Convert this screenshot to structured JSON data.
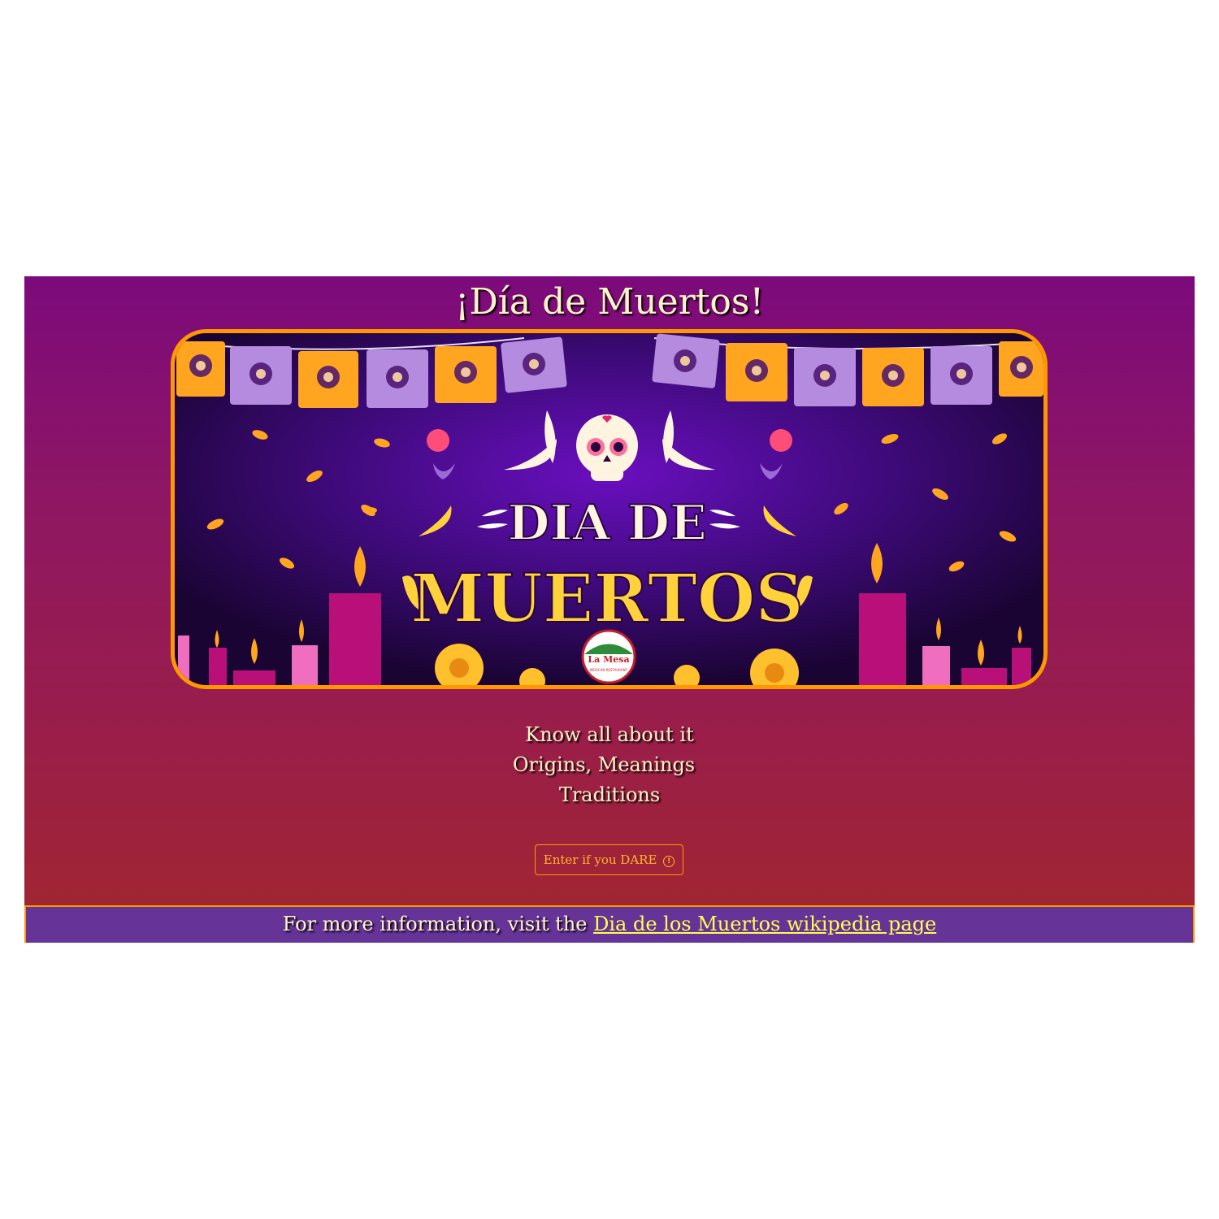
{
  "page": {
    "title": "¡Día de Muertos!",
    "banner": {
      "line1": "DIA DE",
      "line2": "MUERTOS",
      "logo_text": "La Mesa",
      "logo_subtext": "MEXICAN RESTAURANT"
    },
    "tagline": {
      "line1": "Know all about it",
      "line2": "Origins, Meanings",
      "line3": "Traditions"
    },
    "enter_button": {
      "label": "Enter if you DARE",
      "icon": "info-circle-icon"
    },
    "footer": {
      "prefix": "For more information, visit the ",
      "link_text": "Dia de los Muertos wikipedia page"
    }
  },
  "colors": {
    "gradient_top": "#7c0a7c",
    "gradient_bottom": "#a2272e",
    "accent_orange": "#ff9800",
    "title_text": "#fff4c9",
    "footer_bg": "#663399",
    "link": "#ffff4d"
  }
}
